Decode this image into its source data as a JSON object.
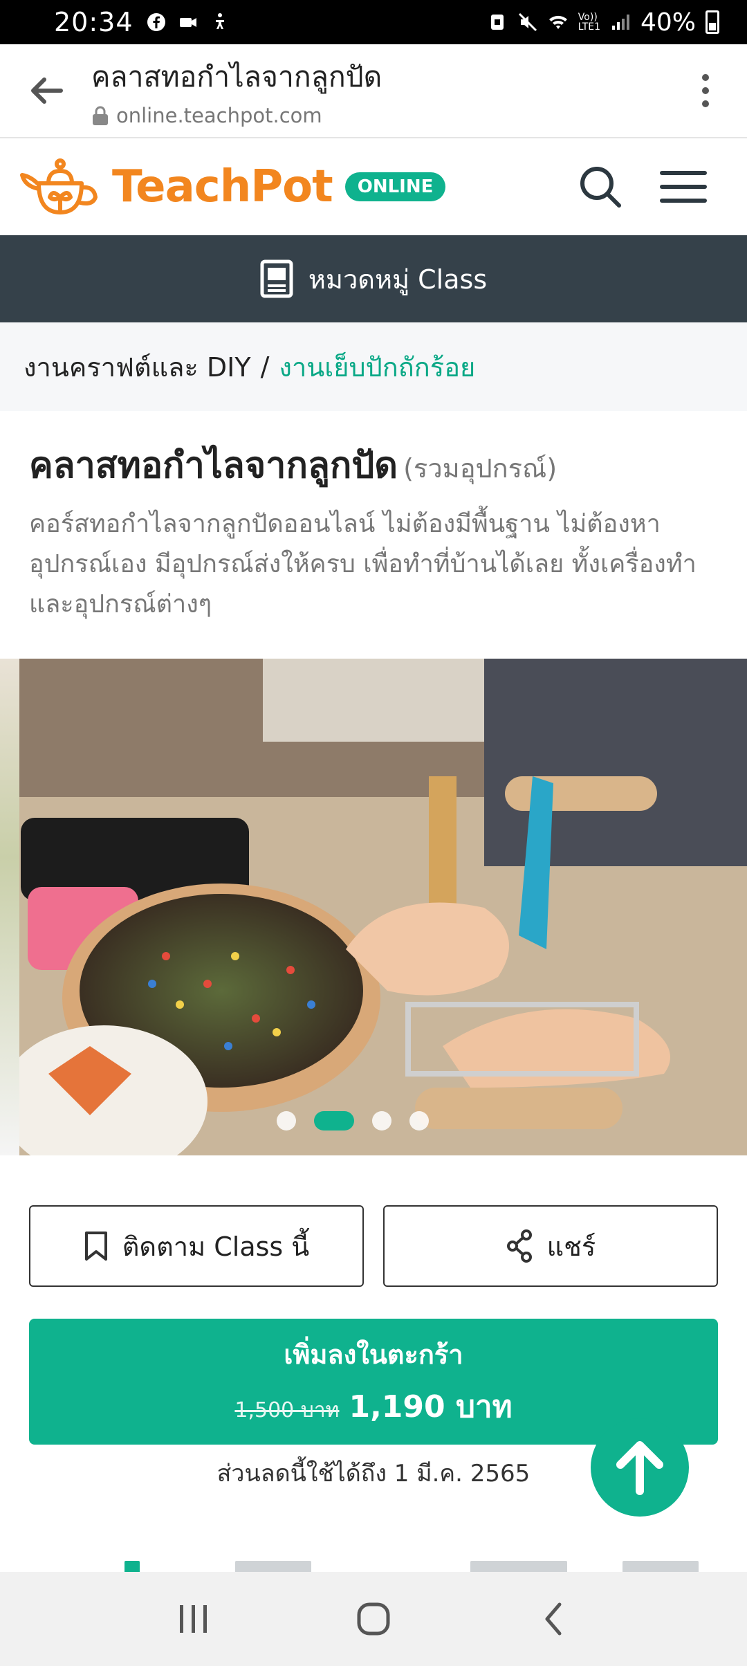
{
  "status_bar": {
    "time": "20:34",
    "battery": "40%",
    "network": "LTE1",
    "network_label": "Vo))",
    "icons": [
      "facebook-icon",
      "video-icon",
      "accessibility-icon",
      "nfc-icon",
      "mute-icon",
      "wifi-icon",
      "signal-icon",
      "battery-icon"
    ]
  },
  "browser": {
    "title": "คลาสทอกำไลจากลูกปัด",
    "url": "online.teachpot.com"
  },
  "site": {
    "logo_text": "TeachPot",
    "logo_badge": "ONLINE",
    "brand_color": "#f2861f",
    "accent_color": "#0fb28e"
  },
  "category_bar": {
    "label": "หมวดหมู่ Class"
  },
  "breadcrumb": {
    "items": [
      "งานคราฟต์และ DIY",
      "งานเย็บปักถักร้อย"
    ],
    "separator": "/"
  },
  "course": {
    "title": "คลาสทอกำไลจากลูกปัด",
    "subtitle": "(รวมอุปกรณ์)",
    "description": "คอร์สทอกำไลจากลูกปัดออนไลน์ ไม่ต้องมีพื้นฐาน ไม่ต้องหาอุปกรณ์เอง มีอุปกรณ์ส่งให้ครบ เพื่อทำที่บ้านได้เลย ทั้งเครื่องทำและอุปกรณ์ต่างๆ"
  },
  "carousel": {
    "slide_count": 4,
    "active_index": 1
  },
  "actions": {
    "follow_label": "ติดตาม Class นี้",
    "share_label": "แชร์"
  },
  "cart": {
    "label": "เพิ่มลงในตะกร้า",
    "old_price": "1,500 บาท",
    "new_price": "1,190 บาท",
    "promo_note": "ส่วนลดนี้ใช้ได้ถึง 1 มี.ค. 2565"
  }
}
